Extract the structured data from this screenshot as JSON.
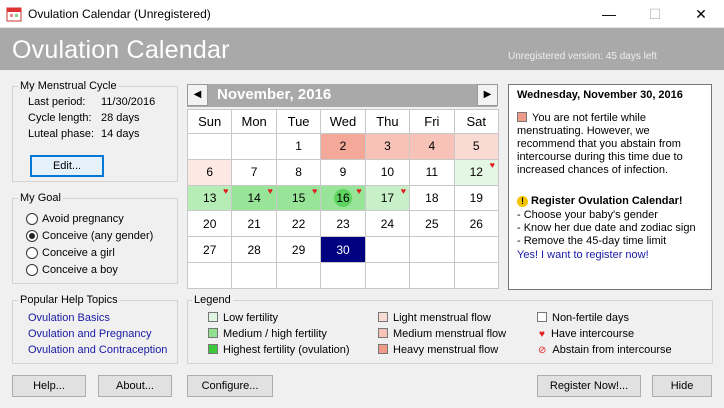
{
  "window": {
    "title": "Ovulation Calendar (Unregistered)",
    "minimize": "—",
    "maximize": "☐",
    "close": "✕"
  },
  "header": {
    "title": "Ovulation Calendar",
    "subtitle": "Unregistered version: 45 days left"
  },
  "cycle": {
    "group_title": "My Menstrual Cycle",
    "last_period_label": "Last period:",
    "last_period": "11/30/2016",
    "cycle_length_label": "Cycle length:",
    "cycle_length": "28 days",
    "luteal_label": "Luteal phase:",
    "luteal": "14 days",
    "edit_button": "Edit..."
  },
  "goal": {
    "group_title": "My Goal",
    "options": [
      "Avoid pregnancy",
      "Conceive (any gender)",
      "Conceive a girl",
      "Conceive a boy"
    ],
    "selected": 1
  },
  "help": {
    "group_title": "Popular Help Topics",
    "links": [
      "Ovulation Basics",
      "Ovulation and Pregnancy",
      "Ovulation and Contraception"
    ]
  },
  "calendar": {
    "month": "November, 2016",
    "prev": "◀",
    "next": "▶",
    "weekdays": [
      "Sun",
      "Mon",
      "Tue",
      "Wed",
      "Thu",
      "Fri",
      "Sat"
    ],
    "weeks": [
      [
        {
          "d": ""
        },
        {
          "d": ""
        },
        {
          "d": "1"
        },
        {
          "d": "2",
          "c": "#f4a89a"
        },
        {
          "d": "3",
          "c": "#f7c2b7"
        },
        {
          "d": "4",
          "c": "#f7c2b7"
        },
        {
          "d": "5",
          "c": "#fadbd4"
        }
      ],
      [
        {
          "d": "6",
          "c": "#fde8e4"
        },
        {
          "d": "7"
        },
        {
          "d": "8"
        },
        {
          "d": "9"
        },
        {
          "d": "10"
        },
        {
          "d": "11"
        },
        {
          "d": "12",
          "c": "#e4f7e4",
          "h": true
        }
      ],
      [
        {
          "d": "13",
          "c": "#b6ecb6",
          "h": true
        },
        {
          "d": "14",
          "c": "#98e498",
          "h": true
        },
        {
          "d": "15",
          "c": "#98e498",
          "h": true
        },
        {
          "d": "16",
          "c": "#98e498",
          "h": true,
          "ov": true
        },
        {
          "d": "17",
          "c": "#c8f0c8",
          "h": true
        },
        {
          "d": "18"
        },
        {
          "d": "19"
        }
      ],
      [
        {
          "d": "20"
        },
        {
          "d": "21"
        },
        {
          "d": "22"
        },
        {
          "d": "23"
        },
        {
          "d": "24"
        },
        {
          "d": "25"
        },
        {
          "d": "26"
        }
      ],
      [
        {
          "d": "27"
        },
        {
          "d": "28"
        },
        {
          "d": "29"
        },
        {
          "d": "30",
          "sel": true
        },
        {
          "d": ""
        },
        {
          "d": ""
        },
        {
          "d": ""
        }
      ],
      [
        {
          "d": ""
        },
        {
          "d": ""
        },
        {
          "d": ""
        },
        {
          "d": ""
        },
        {
          "d": ""
        },
        {
          "d": ""
        },
        {
          "d": ""
        }
      ]
    ]
  },
  "info": {
    "date": "Wednesday, November 30, 2016",
    "message": "You are not fertile while menstruating. However, we recommend that you abstain from intercourse during this time due to increased chances of infection.",
    "register_title": "Register Ovulation Calendar!",
    "bullets": [
      "- Choose your baby's gender",
      "- Know her due date and zodiac sign",
      "- Remove the 45-day time limit"
    ],
    "register_link": "Yes! I want to register now!"
  },
  "legend": {
    "group_title": "Legend",
    "items": [
      {
        "label": "Low fertility",
        "color": "#dff5df"
      },
      {
        "label": "Light menstrual flow",
        "color": "#fadbd4"
      },
      {
        "label": "Non-fertile days",
        "color": "#ffffff"
      },
      {
        "label": "Medium / high fertility",
        "color": "#8fe08f"
      },
      {
        "label": "Medium menstrual flow",
        "color": "#f7c2b7"
      },
      {
        "label": "Have intercourse",
        "icon": "heart-icon"
      },
      {
        "label": "Highest fertility (ovulation)",
        "color": "#3ec83e"
      },
      {
        "label": "Heavy menstrual flow",
        "color": "#f19a8a"
      },
      {
        "label": "Abstain from intercourse",
        "icon": "no-sign-icon"
      }
    ]
  },
  "buttons": {
    "help": "Help...",
    "about": "About...",
    "configure": "Configure...",
    "register": "Register Now!...",
    "hide": "Hide"
  }
}
